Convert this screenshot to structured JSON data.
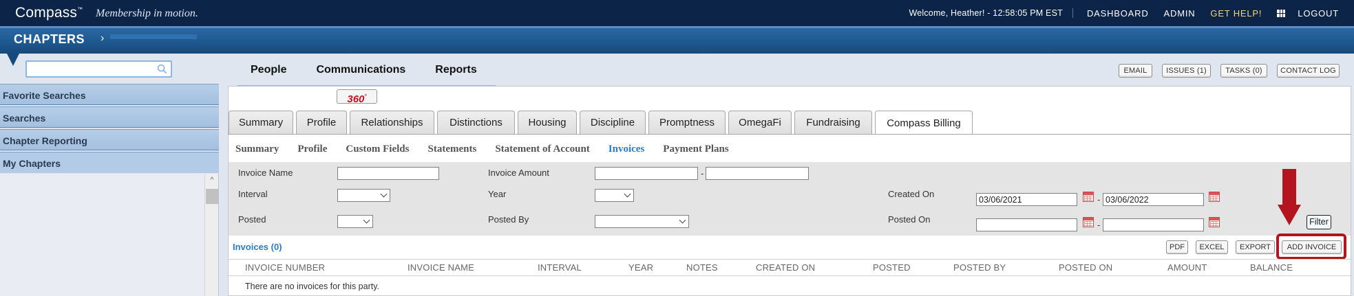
{
  "header": {
    "logo": "Compass",
    "logo_mark": "™",
    "tagline": "Membership in motion.",
    "welcome": "Welcome, Heather! - 12:58:05 PM EST",
    "links": [
      "DASHBOARD",
      "ADMIN",
      "GET HELP!",
      "LOGOUT"
    ]
  },
  "section": {
    "title": "CHAPTERS",
    "chevron": "›"
  },
  "search": {
    "value": "",
    "placeholder": ""
  },
  "main_menu": [
    "People",
    "Communications",
    "Reports"
  ],
  "toolbar_buttons": [
    "EMAIL",
    "ISSUES (1)",
    "TASKS (0)",
    "CONTACT LOG"
  ],
  "sidebar": {
    "items": [
      "Favorite Searches",
      "Searches",
      "Chapter Reporting",
      "My Chapters"
    ],
    "scroll_up": "^"
  },
  "btn360": {
    "label": "360",
    "mark": "°"
  },
  "tabs": [
    "Summary",
    "Profile",
    "Relationships",
    "Distinctions",
    "Housing",
    "Discipline",
    "Promptness",
    "OmegaFi",
    "Fundraising",
    "Compass Billing"
  ],
  "active_tab": "Compass Billing",
  "subtabs": [
    "Summary",
    "Profile",
    "Custom Fields",
    "Statements",
    "Statement of Account",
    "Invoices",
    "Payment Plans"
  ],
  "active_subtab": "Invoices",
  "filters": {
    "invoice_name": {
      "label": "Invoice Name",
      "value": ""
    },
    "invoice_amount": {
      "label": "Invoice Amount",
      "from": "",
      "to": "",
      "separator": "-"
    },
    "interval": {
      "label": "Interval",
      "value": ""
    },
    "year": {
      "label": "Year",
      "value": ""
    },
    "created_on": {
      "label": "Created On",
      "from": "03/06/2021",
      "to": "03/06/2022",
      "separator": "-"
    },
    "posted": {
      "label": "Posted",
      "value": ""
    },
    "posted_by": {
      "label": "Posted By",
      "value": ""
    },
    "posted_on": {
      "label": "Posted On",
      "from": "",
      "to": "",
      "separator": "-"
    },
    "filter_button": "Filter"
  },
  "invoices": {
    "title": "Invoices (0)",
    "actions": [
      "PDF",
      "EXCEL",
      "EXPORT",
      "ADD INVOICE"
    ],
    "columns": [
      "INVOICE NUMBER",
      "INVOICE NAME",
      "INTERVAL",
      "YEAR",
      "NOTES",
      "CREATED ON",
      "POSTED",
      "POSTED BY",
      "POSTED ON",
      "AMOUNT",
      "BALANCE"
    ],
    "empty_message": "There are no invoices for this party."
  },
  "colors": {
    "header_bg": "#0b2447",
    "band": "#1f5991",
    "accent_link": "#2a7bc6",
    "annotation_red": "#b3141d",
    "help_link": "#f3d67e"
  }
}
